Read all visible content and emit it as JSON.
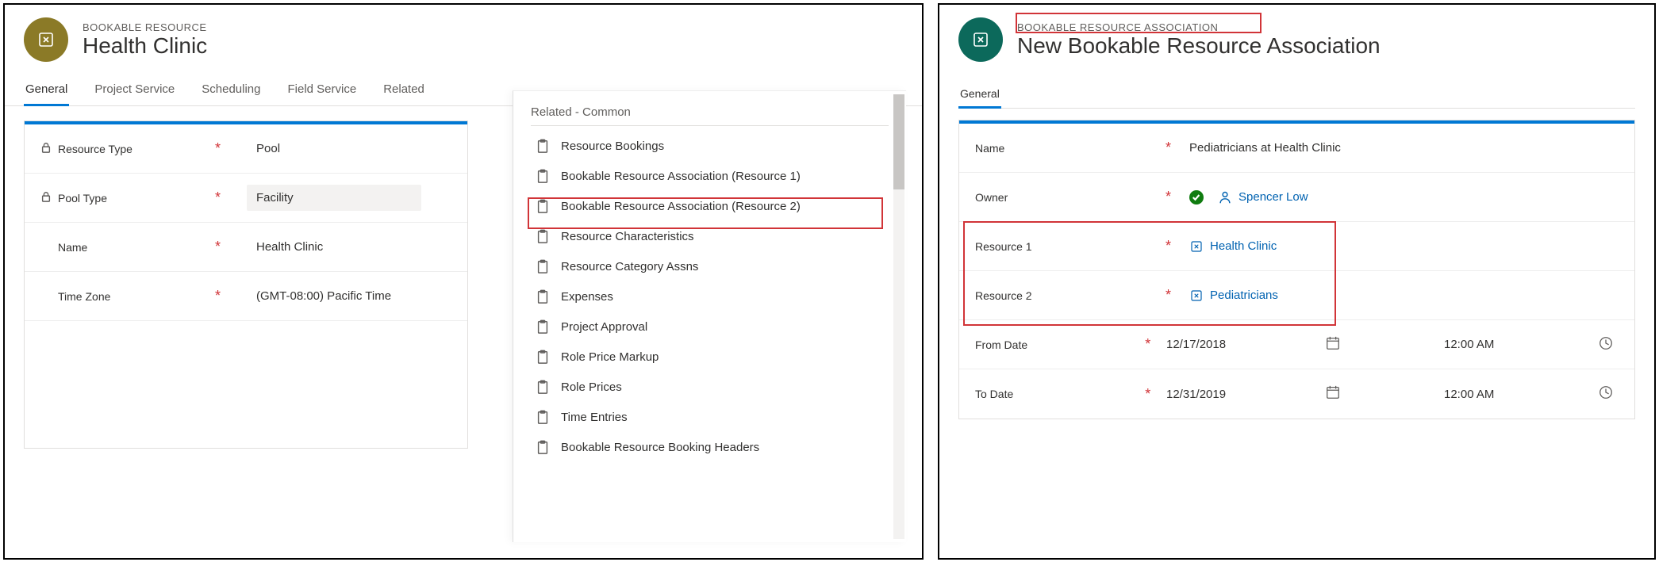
{
  "left": {
    "eyebrow": "BOOKABLE RESOURCE",
    "title": "Health Clinic",
    "tabs": [
      "General",
      "Project Service",
      "Scheduling",
      "Field Service",
      "Related"
    ],
    "active_tab": "General",
    "fields": {
      "resource_type": {
        "label": "Resource Type",
        "value": "Pool",
        "locked": true
      },
      "pool_type": {
        "label": "Pool Type",
        "value": "Facility",
        "locked": true
      },
      "name": {
        "label": "Name",
        "value": "Health Clinic"
      },
      "time_zone": {
        "label": "Time Zone",
        "value": "(GMT-08:00) Pacific Time"
      }
    },
    "related": {
      "heading": "Related - Common",
      "items": [
        "Resource Bookings",
        "Bookable Resource Association (Resource 1)",
        "Bookable Resource Association (Resource 2)",
        "Resource Characteristics",
        "Resource Category Assns",
        "Expenses",
        "Project Approval",
        "Role Price Markup",
        "Role Prices",
        "Time Entries",
        "Bookable Resource Booking Headers"
      ],
      "highlight_index": 2
    }
  },
  "right": {
    "eyebrow": "BOOKABLE RESOURCE ASSOCIATION",
    "title": "New Bookable Resource Association",
    "tab": "General",
    "fields": {
      "name": {
        "label": "Name",
        "value": "Pediatricians at Health Clinic"
      },
      "owner": {
        "label": "Owner",
        "value": "Spencer Low"
      },
      "resource1": {
        "label": "Resource 1",
        "value": "Health Clinic"
      },
      "resource2": {
        "label": "Resource 2",
        "value": "Pediatricians"
      },
      "from_date": {
        "label": "From Date",
        "date": "12/17/2018",
        "time": "12:00 AM"
      },
      "to_date": {
        "label": "To Date",
        "date": "12/31/2019",
        "time": "12:00 AM"
      }
    }
  }
}
